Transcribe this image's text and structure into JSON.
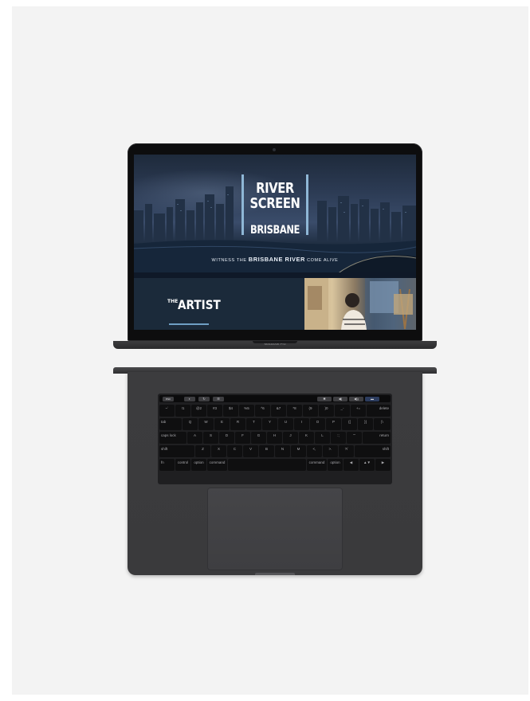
{
  "website": {
    "brand_line1": "RIVER",
    "brand_line2": "SCREEN",
    "brand_line3": "BRISBANE",
    "tagline_prefix": "WITNESS THE",
    "tagline_bold": "BRISBANE RIVER",
    "tagline_suffix": "COME ALIVE",
    "section_small": "THE",
    "section_big": "ARTIST"
  },
  "laptop": {
    "model_label": "MacBook Pro"
  },
  "touchbar": {
    "left": [
      "esc",
      "◐",
      "↻",
      "☰"
    ],
    "right": [
      "✱",
      "◀)",
      "◀))",
      "▬"
    ]
  },
  "keyboard": {
    "row1": [
      "~`",
      "!1",
      "@2",
      "#3",
      "$4",
      "%5",
      "^6",
      "&7",
      "*8",
      "(9",
      ")0",
      "_-",
      "+=",
      "delete"
    ],
    "row2": [
      "tab",
      "Q",
      "W",
      "E",
      "R",
      "T",
      "Y",
      "U",
      "I",
      "O",
      "P",
      "{[",
      "}]",
      "|\\"
    ],
    "row3": [
      "caps lock",
      "A",
      "S",
      "D",
      "F",
      "G",
      "H",
      "J",
      "K",
      "L",
      ":;",
      "\"'",
      "return"
    ],
    "row4": [
      "shift",
      "Z",
      "X",
      "C",
      "V",
      "B",
      "N",
      "M",
      "<,",
      ">.",
      "?/",
      "shift"
    ],
    "row5": [
      "fn",
      "control",
      "option",
      "command",
      "",
      "command",
      "option",
      "◀",
      "▲▼",
      "▶"
    ]
  },
  "colors": {
    "accent": "#8fb7d6",
    "page_band": "#1b2a3a"
  }
}
